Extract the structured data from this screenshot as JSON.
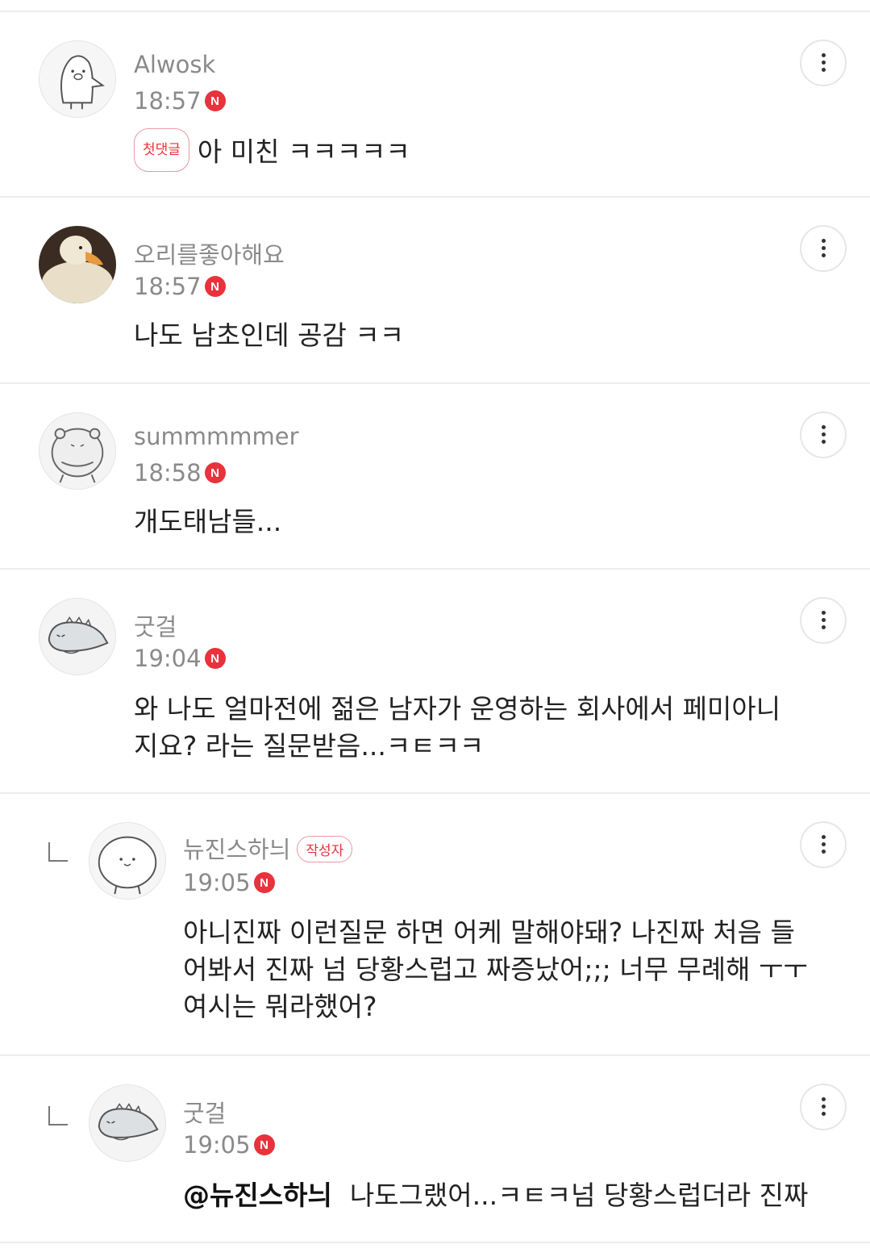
{
  "comments": [
    {
      "name": "Alwosk",
      "time": "18:57",
      "new_badge": "N",
      "tag": "첫댓글",
      "text": "아 미친 ㅋㅋㅋㅋㅋ"
    },
    {
      "name": "오리를좋아해요",
      "time": "18:57",
      "new_badge": "N",
      "text": "나도 남초인데 공감 ㅋㅋ"
    },
    {
      "name": "summmmmer",
      "time": "18:58",
      "new_badge": "N",
      "text": "개도태남들..."
    },
    {
      "name": "굿걸",
      "time": "19:04",
      "new_badge": "N",
      "text_line1": "와 나도 얼마전에 젊은 남자가 운영하는 회사에서 페미아니",
      "text_line2": "지요? 라는 질문받음...ㅋㅌㅋㅋ"
    },
    {
      "name": "뉴진스하늬",
      "name_tag": "작성자",
      "time": "19:05",
      "new_badge": "N",
      "text_line1": "아니진짜 이런질문 하면 어케 말해야돼? 나진짜 처음 들",
      "text_line2": "어봐서 진짜 넘 당황스럽고 짜증났어;;; 너무 무례해 ㅜㅜ",
      "text_line3": "여시는 뭐라했어?"
    },
    {
      "name": "굿걸",
      "time": "19:05",
      "new_badge": "N",
      "mention": "@뉴진스하늬",
      "text": "나도그랬어...ㅋㅌㅋ넘 당황스럽더라 진짜"
    }
  ],
  "icons": {
    "more": "more-vertical-icon",
    "reply": "reply-arrow-icon"
  },
  "colors": {
    "accent_red": "#e8323c",
    "muted_text": "#8a8a8a",
    "divider": "#ececec"
  }
}
